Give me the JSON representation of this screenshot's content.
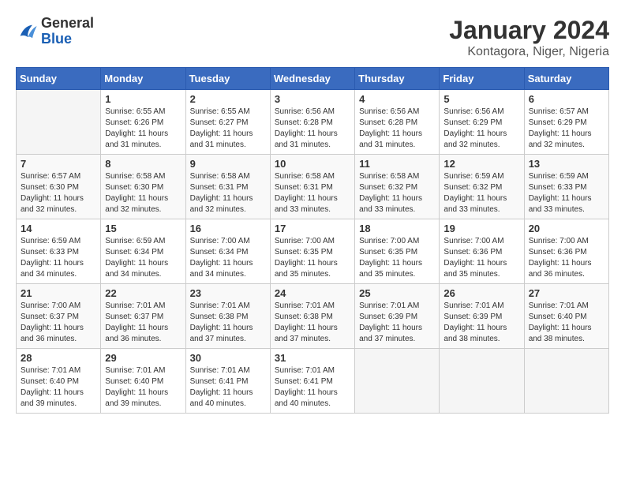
{
  "header": {
    "logo": {
      "general": "General",
      "blue": "Blue"
    },
    "title": "January 2024",
    "subtitle": "Kontagora, Niger, Nigeria"
  },
  "days_of_week": [
    "Sunday",
    "Monday",
    "Tuesday",
    "Wednesday",
    "Thursday",
    "Friday",
    "Saturday"
  ],
  "weeks": [
    [
      {
        "day": "",
        "sunrise": "",
        "sunset": "",
        "daylight": ""
      },
      {
        "day": "1",
        "sunrise": "Sunrise: 6:55 AM",
        "sunset": "Sunset: 6:26 PM",
        "daylight": "Daylight: 11 hours and 31 minutes."
      },
      {
        "day": "2",
        "sunrise": "Sunrise: 6:55 AM",
        "sunset": "Sunset: 6:27 PM",
        "daylight": "Daylight: 11 hours and 31 minutes."
      },
      {
        "day": "3",
        "sunrise": "Sunrise: 6:56 AM",
        "sunset": "Sunset: 6:28 PM",
        "daylight": "Daylight: 11 hours and 31 minutes."
      },
      {
        "day": "4",
        "sunrise": "Sunrise: 6:56 AM",
        "sunset": "Sunset: 6:28 PM",
        "daylight": "Daylight: 11 hours and 31 minutes."
      },
      {
        "day": "5",
        "sunrise": "Sunrise: 6:56 AM",
        "sunset": "Sunset: 6:29 PM",
        "daylight": "Daylight: 11 hours and 32 minutes."
      },
      {
        "day": "6",
        "sunrise": "Sunrise: 6:57 AM",
        "sunset": "Sunset: 6:29 PM",
        "daylight": "Daylight: 11 hours and 32 minutes."
      }
    ],
    [
      {
        "day": "7",
        "sunrise": "Sunrise: 6:57 AM",
        "sunset": "Sunset: 6:30 PM",
        "daylight": "Daylight: 11 hours and 32 minutes."
      },
      {
        "day": "8",
        "sunrise": "Sunrise: 6:58 AM",
        "sunset": "Sunset: 6:30 PM",
        "daylight": "Daylight: 11 hours and 32 minutes."
      },
      {
        "day": "9",
        "sunrise": "Sunrise: 6:58 AM",
        "sunset": "Sunset: 6:31 PM",
        "daylight": "Daylight: 11 hours and 32 minutes."
      },
      {
        "day": "10",
        "sunrise": "Sunrise: 6:58 AM",
        "sunset": "Sunset: 6:31 PM",
        "daylight": "Daylight: 11 hours and 33 minutes."
      },
      {
        "day": "11",
        "sunrise": "Sunrise: 6:58 AM",
        "sunset": "Sunset: 6:32 PM",
        "daylight": "Daylight: 11 hours and 33 minutes."
      },
      {
        "day": "12",
        "sunrise": "Sunrise: 6:59 AM",
        "sunset": "Sunset: 6:32 PM",
        "daylight": "Daylight: 11 hours and 33 minutes."
      },
      {
        "day": "13",
        "sunrise": "Sunrise: 6:59 AM",
        "sunset": "Sunset: 6:33 PM",
        "daylight": "Daylight: 11 hours and 33 minutes."
      }
    ],
    [
      {
        "day": "14",
        "sunrise": "Sunrise: 6:59 AM",
        "sunset": "Sunset: 6:33 PM",
        "daylight": "Daylight: 11 hours and 34 minutes."
      },
      {
        "day": "15",
        "sunrise": "Sunrise: 6:59 AM",
        "sunset": "Sunset: 6:34 PM",
        "daylight": "Daylight: 11 hours and 34 minutes."
      },
      {
        "day": "16",
        "sunrise": "Sunrise: 7:00 AM",
        "sunset": "Sunset: 6:34 PM",
        "daylight": "Daylight: 11 hours and 34 minutes."
      },
      {
        "day": "17",
        "sunrise": "Sunrise: 7:00 AM",
        "sunset": "Sunset: 6:35 PM",
        "daylight": "Daylight: 11 hours and 35 minutes."
      },
      {
        "day": "18",
        "sunrise": "Sunrise: 7:00 AM",
        "sunset": "Sunset: 6:35 PM",
        "daylight": "Daylight: 11 hours and 35 minutes."
      },
      {
        "day": "19",
        "sunrise": "Sunrise: 7:00 AM",
        "sunset": "Sunset: 6:36 PM",
        "daylight": "Daylight: 11 hours and 35 minutes."
      },
      {
        "day": "20",
        "sunrise": "Sunrise: 7:00 AM",
        "sunset": "Sunset: 6:36 PM",
        "daylight": "Daylight: 11 hours and 36 minutes."
      }
    ],
    [
      {
        "day": "21",
        "sunrise": "Sunrise: 7:00 AM",
        "sunset": "Sunset: 6:37 PM",
        "daylight": "Daylight: 11 hours and 36 minutes."
      },
      {
        "day": "22",
        "sunrise": "Sunrise: 7:01 AM",
        "sunset": "Sunset: 6:37 PM",
        "daylight": "Daylight: 11 hours and 36 minutes."
      },
      {
        "day": "23",
        "sunrise": "Sunrise: 7:01 AM",
        "sunset": "Sunset: 6:38 PM",
        "daylight": "Daylight: 11 hours and 37 minutes."
      },
      {
        "day": "24",
        "sunrise": "Sunrise: 7:01 AM",
        "sunset": "Sunset: 6:38 PM",
        "daylight": "Daylight: 11 hours and 37 minutes."
      },
      {
        "day": "25",
        "sunrise": "Sunrise: 7:01 AM",
        "sunset": "Sunset: 6:39 PM",
        "daylight": "Daylight: 11 hours and 37 minutes."
      },
      {
        "day": "26",
        "sunrise": "Sunrise: 7:01 AM",
        "sunset": "Sunset: 6:39 PM",
        "daylight": "Daylight: 11 hours and 38 minutes."
      },
      {
        "day": "27",
        "sunrise": "Sunrise: 7:01 AM",
        "sunset": "Sunset: 6:40 PM",
        "daylight": "Daylight: 11 hours and 38 minutes."
      }
    ],
    [
      {
        "day": "28",
        "sunrise": "Sunrise: 7:01 AM",
        "sunset": "Sunset: 6:40 PM",
        "daylight": "Daylight: 11 hours and 39 minutes."
      },
      {
        "day": "29",
        "sunrise": "Sunrise: 7:01 AM",
        "sunset": "Sunset: 6:40 PM",
        "daylight": "Daylight: 11 hours and 39 minutes."
      },
      {
        "day": "30",
        "sunrise": "Sunrise: 7:01 AM",
        "sunset": "Sunset: 6:41 PM",
        "daylight": "Daylight: 11 hours and 40 minutes."
      },
      {
        "day": "31",
        "sunrise": "Sunrise: 7:01 AM",
        "sunset": "Sunset: 6:41 PM",
        "daylight": "Daylight: 11 hours and 40 minutes."
      },
      {
        "day": "",
        "sunrise": "",
        "sunset": "",
        "daylight": ""
      },
      {
        "day": "",
        "sunrise": "",
        "sunset": "",
        "daylight": ""
      },
      {
        "day": "",
        "sunrise": "",
        "sunset": "",
        "daylight": ""
      }
    ]
  ]
}
